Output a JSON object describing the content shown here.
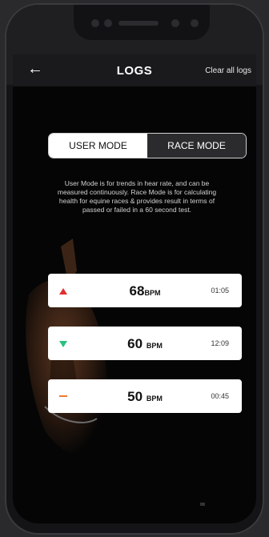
{
  "header": {
    "title": "LOGS",
    "clear_label": "Clear all logs",
    "back_icon": "←"
  },
  "mode_toggle": {
    "user": "USER MODE",
    "race": "RACE MODE",
    "selected": "USER MODE"
  },
  "description": "User Mode is for trends in hear rate, and can be measured continuously. Race Mode is for calculating health for equine races & provides result in terms of passed or failed in a 60 second test.",
  "logs": [
    {
      "bpm": "68",
      "unit": "BPM",
      "time": "01:05",
      "trend": "up",
      "trend_color": "#e0302f"
    },
    {
      "bpm": "60",
      "unit": "BPM",
      "time": "12:09",
      "trend": "down",
      "trend_color": "#27c27a"
    },
    {
      "bpm": "50",
      "unit": "BPM",
      "time": "00:45",
      "trend": "flat",
      "trend_color": "#f07a2f"
    }
  ]
}
